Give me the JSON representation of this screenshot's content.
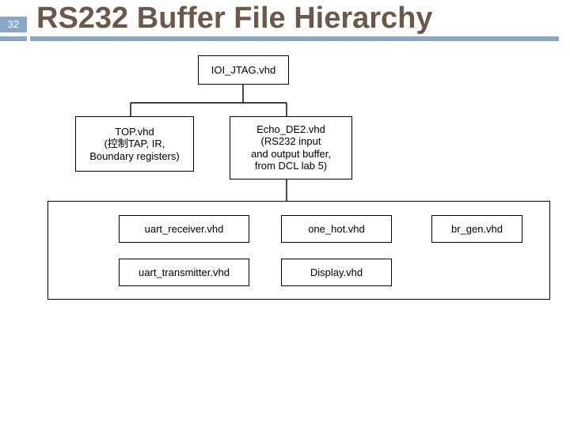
{
  "slide": {
    "number": "32",
    "title": "RS232 Buffer File Hierarchy"
  },
  "nodes": {
    "root": "IOI_JTAG.vhd",
    "left": "TOP.vhd\n(控制TAP, IR,\nBoundary registers)",
    "right": "Echo_DE2.vhd\n(RS232 input\nand output buffer,\nfrom DCL lab 5)",
    "c1": "uart_receiver.vhd",
    "c2": "one_hot.vhd",
    "c3": "br_gen.vhd",
    "c4": "uart_transmitter.vhd",
    "c5": "Display.vhd"
  }
}
